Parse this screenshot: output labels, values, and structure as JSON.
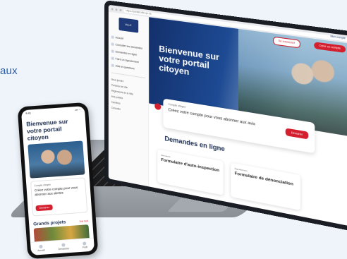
{
  "background_text": "aux",
  "laptop": {
    "url": "https://portail.ville.qc.ca",
    "logo_text": "VILLE",
    "account_label": "Mon compte",
    "sidebar": [
      {
        "label": "Accueil"
      },
      {
        "label": "Consulter les demandes"
      },
      {
        "label": "Demandes en ligne"
      },
      {
        "label": "Faire un signalement"
      },
      {
        "label": "Aide et questions"
      }
    ],
    "sidebar_links": [
      "Nous joindre",
      "Portail de la Ville",
      "Règlements de la Ville",
      "Avis publics",
      "Carrières",
      "Consulter"
    ],
    "hero_title": "Bienvenue sur votre portail citoyen",
    "hero_btn_1": "Se connecter",
    "hero_btn_2": "Créer un compte",
    "cta_caption": "Compte citoyen",
    "cta_text": "Créez votre compte pour vous abonner aux avis",
    "cta_button": "Démarrer",
    "section_title": "Demandes en ligne",
    "cards": [
      {
        "caption": "Demande",
        "name": "Formulaire d'auto-inspection"
      },
      {
        "caption": "Signalement",
        "name": "Formulaire de dénonciation"
      }
    ]
  },
  "phone": {
    "time": "9:41",
    "signal": "••• ◔",
    "title": "Bienvenue sur votre portail citoyen",
    "card_caption": "Compte citoyen",
    "card_text": "Créez votre compte pour vous abonner aux alertes",
    "card_button": "Démarrer",
    "section_title": "Grands projets",
    "section_link": "Voir tout",
    "nav": [
      {
        "label": "Accueil"
      },
      {
        "label": "Demandes"
      },
      {
        "label": "Profil"
      }
    ]
  },
  "colors": {
    "brand_blue": "#1e3a78",
    "accent_red": "#d41f2e"
  }
}
